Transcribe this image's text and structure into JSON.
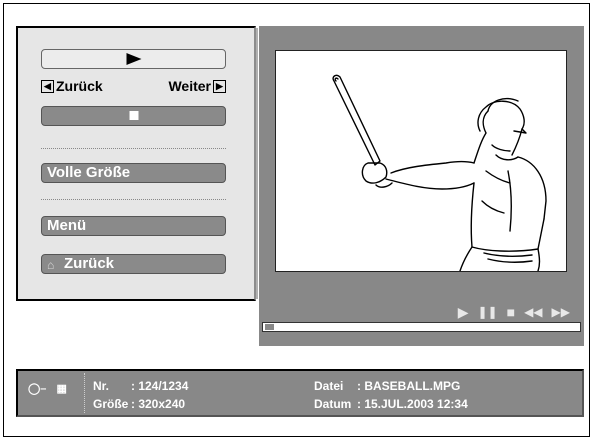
{
  "menu": {
    "play_icon": "play-icon",
    "back_label": "Zurück",
    "next_label": "Weiter",
    "stop_icon": "stop-icon",
    "full_size_label": "Volle Größe",
    "menu_label": "Menü",
    "return_label": "Zurück"
  },
  "player": {
    "controls": [
      "play-icon",
      "pause-icon",
      "stop-icon",
      "rewind-icon",
      "fast-forward-icon"
    ],
    "progress_fraction": 0.03,
    "colors": {
      "panel": "#888888",
      "controls": "#e8e8e8"
    }
  },
  "info": {
    "nr_label": "Nr.",
    "nr_value": ": 124/1234",
    "size_label": "Größe",
    "size_value": ": 320x240",
    "file_label": "Datei",
    "file_value": ": BASEBALL.MPG",
    "date_label": "Datum",
    "date_value": ": 15.JUL.2003 12:34"
  }
}
